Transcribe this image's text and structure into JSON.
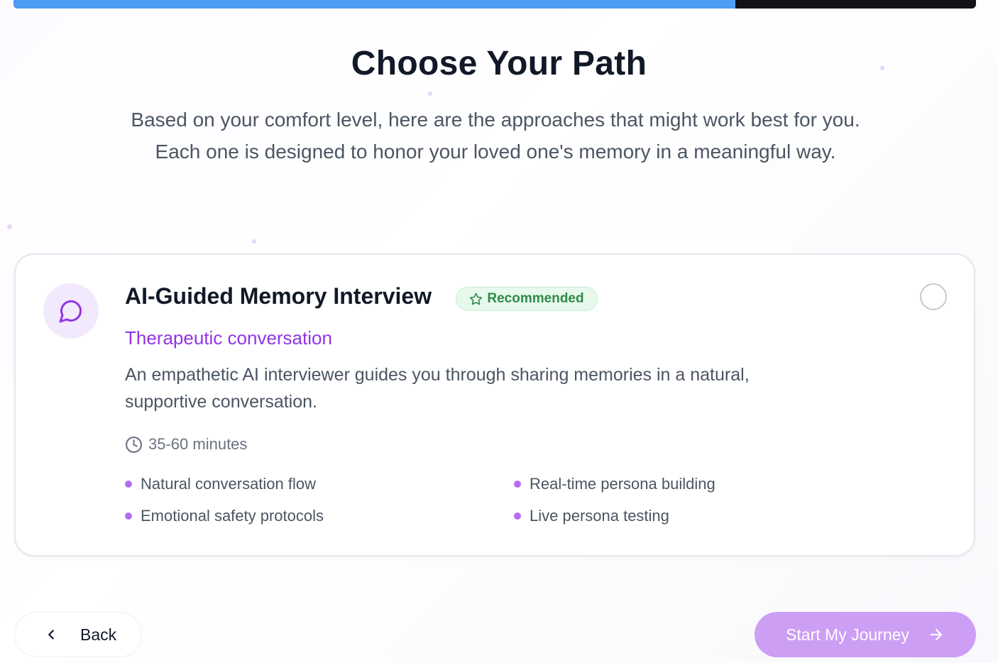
{
  "progress": {
    "percent": 75,
    "fill_color": "#4f9cf5",
    "track_color": "#111318"
  },
  "header": {
    "title": "Choose Your Path",
    "subtitle": "Based on your comfort level, here are the approaches that might work best for you. Each one is designed to honor your loved one's memory in a meaningful way."
  },
  "option": {
    "icon": "message-circle-icon",
    "title": "AI-Guided Memory Interview",
    "badge": {
      "icon": "star-icon",
      "label": "Recommended",
      "color": "#2f8a46"
    },
    "subtitle": "Therapeutic conversation",
    "description": "An empathetic AI interviewer guides you through sharing memories in a natural, supportive conversation.",
    "duration": {
      "icon": "clock-icon",
      "label": "35-60 minutes"
    },
    "features": [
      "Natural conversation flow",
      "Real-time persona building",
      "Emotional safety protocols",
      "Live persona testing"
    ],
    "selected": false,
    "accent_color": "#9135e3"
  },
  "footer": {
    "back_label": "Back",
    "back_icon": "chevron-left-icon",
    "start_label": "Start My Journey",
    "start_icon": "arrow-right-icon",
    "start_color": "#cc9ef4"
  }
}
